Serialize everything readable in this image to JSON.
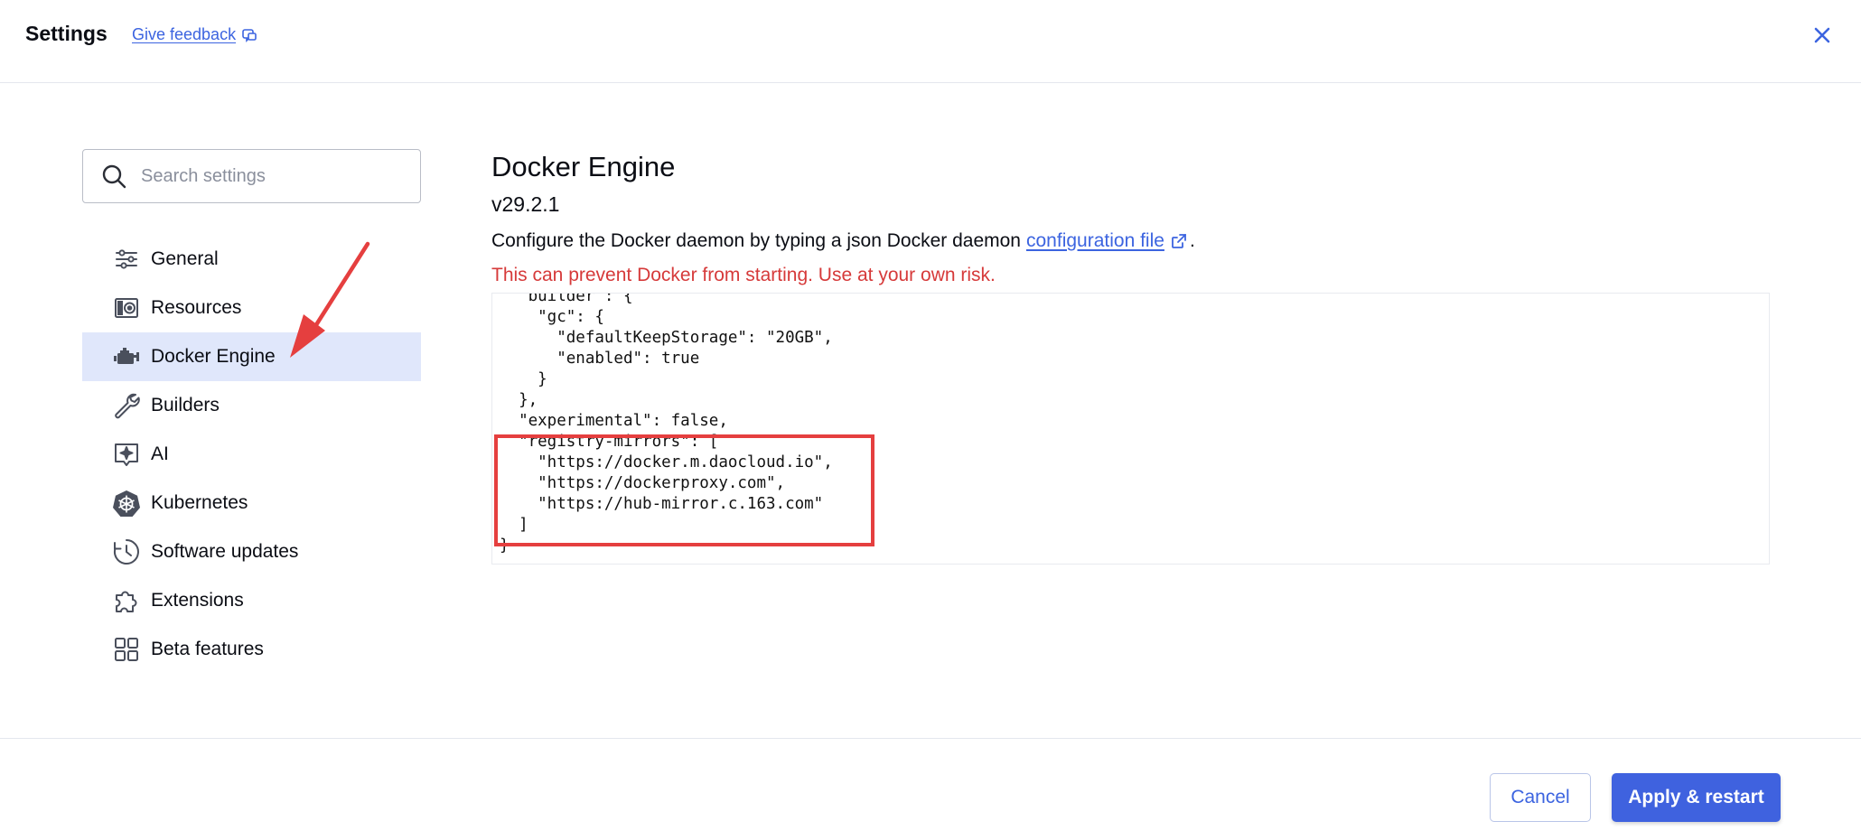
{
  "header": {
    "title": "Settings",
    "feedback_label": "Give feedback"
  },
  "search": {
    "placeholder": "Search settings"
  },
  "sidebar": {
    "items": [
      {
        "label": "General",
        "icon": "sliders-icon"
      },
      {
        "label": "Resources",
        "icon": "disk-icon"
      },
      {
        "label": "Docker Engine",
        "icon": "engine-icon",
        "active": true
      },
      {
        "label": "Builders",
        "icon": "wrench-icon"
      },
      {
        "label": "AI",
        "icon": "ai-sparkle-icon"
      },
      {
        "label": "Kubernetes",
        "icon": "helm-icon"
      },
      {
        "label": "Software updates",
        "icon": "clock-icon"
      },
      {
        "label": "Extensions",
        "icon": "puzzle-icon"
      },
      {
        "label": "Beta features",
        "icon": "grid-icon"
      }
    ]
  },
  "main": {
    "title": "Docker Engine",
    "version": "v29.2.1",
    "description": "Configure the Docker daemon by typing a json Docker daemon",
    "config_link": "configuration file",
    "period": ".",
    "warning": "This can prevent Docker from starting. Use at your own risk.",
    "config_json": "  \"builder\": {\n    \"gc\": {\n      \"defaultKeepStorage\": \"20GB\",\n      \"enabled\": true\n    }\n  },\n  \"experimental\": false,\n  \"registry-mirrors\": [\n    \"https://docker.m.daocloud.io\",\n    \"https://dockerproxy.com\",\n    \"https://hub-mirror.c.163.com\"\n  ]\n}"
  },
  "footer": {
    "cancel_label": "Cancel",
    "apply_label": "Apply & restart"
  },
  "colors": {
    "accent": "#3f62df",
    "link": "#3c64e0",
    "warning": "#d63a3a",
    "active_bg": "#e0e7fb",
    "annotation": "#e53f3f"
  }
}
